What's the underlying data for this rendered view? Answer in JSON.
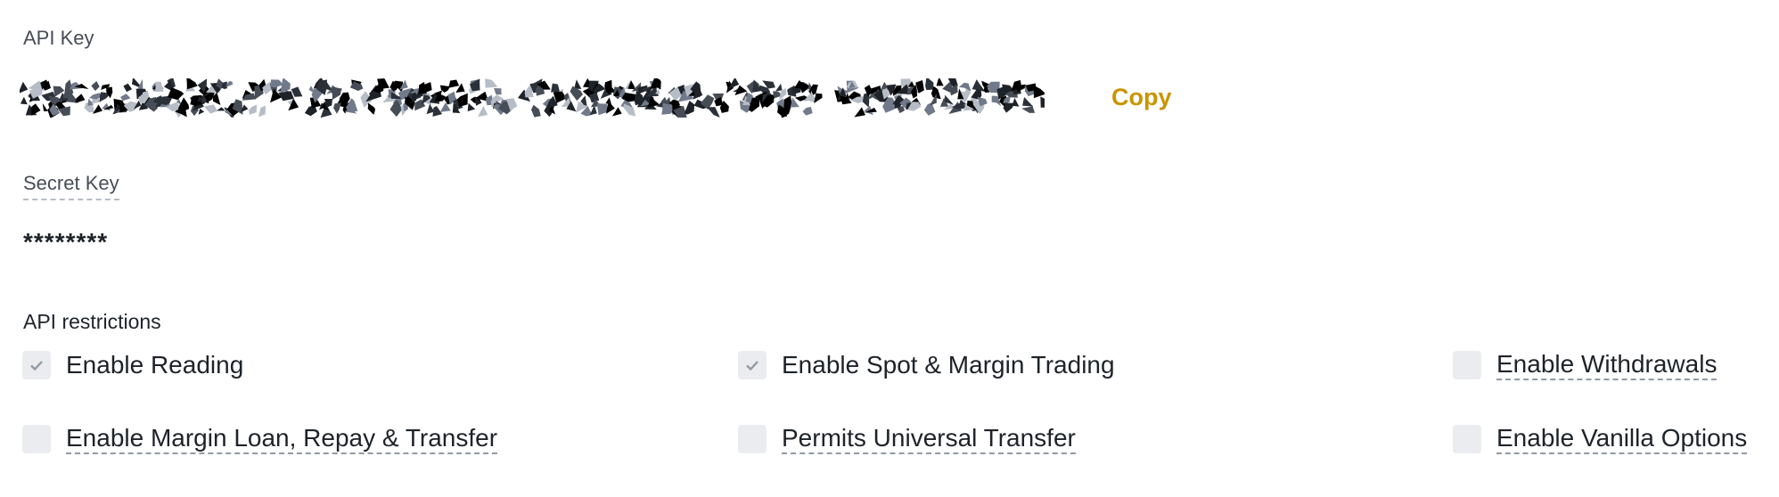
{
  "api_key": {
    "label": "API Key",
    "copy_label": "Copy",
    "value_redacted": true
  },
  "secret_key": {
    "label": "Secret Key",
    "value": "********"
  },
  "restrictions": {
    "label": "API restrictions",
    "items": [
      {
        "label": "Enable Reading",
        "checked": true,
        "tooltip": false
      },
      {
        "label": "Enable Spot & Margin Trading",
        "checked": true,
        "tooltip": false
      },
      {
        "label": "Enable Withdrawals",
        "checked": false,
        "tooltip": true
      },
      {
        "label": "Enable Margin Loan, Repay & Transfer",
        "checked": false,
        "tooltip": true
      },
      {
        "label": "Permits Universal Transfer",
        "checked": false,
        "tooltip": true
      },
      {
        "label": "Enable Vanilla Options",
        "checked": false,
        "tooltip": true
      }
    ]
  },
  "colors": {
    "accent": "#c99400",
    "checkbox_bg": "#eaecef",
    "check_mark": "#929aa5"
  }
}
